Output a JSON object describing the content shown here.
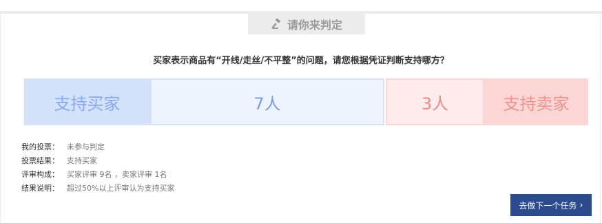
{
  "header": {
    "tab_label": "请你来判定",
    "tab_icon": "gavel-icon"
  },
  "question": "买家表示商品有“开线/走丝/不平整”的问题，请您根据凭证判断支持哪方？",
  "vote_bar": {
    "buyer_label": "支持买家",
    "buyer_count": "7人",
    "seller_count": "3人",
    "seller_label": "支持卖家",
    "colors": {
      "buyer": "#d3e1fb",
      "seller": "#fbd6d4"
    }
  },
  "info": [
    {
      "key": "我的投票：",
      "value": "未参与判定"
    },
    {
      "key": "投票结果：",
      "value": "支持买家"
    },
    {
      "key": "评审构成：",
      "value": "买家评审 9名 ，卖家评审 1名"
    },
    {
      "key": "结果说明：",
      "value": "超过50%以上评审认为支持买家"
    }
  ],
  "next_button": {
    "label": "去做下一个任务",
    "icon": "chevron-right-icon",
    "color": "#2c4a8e"
  }
}
